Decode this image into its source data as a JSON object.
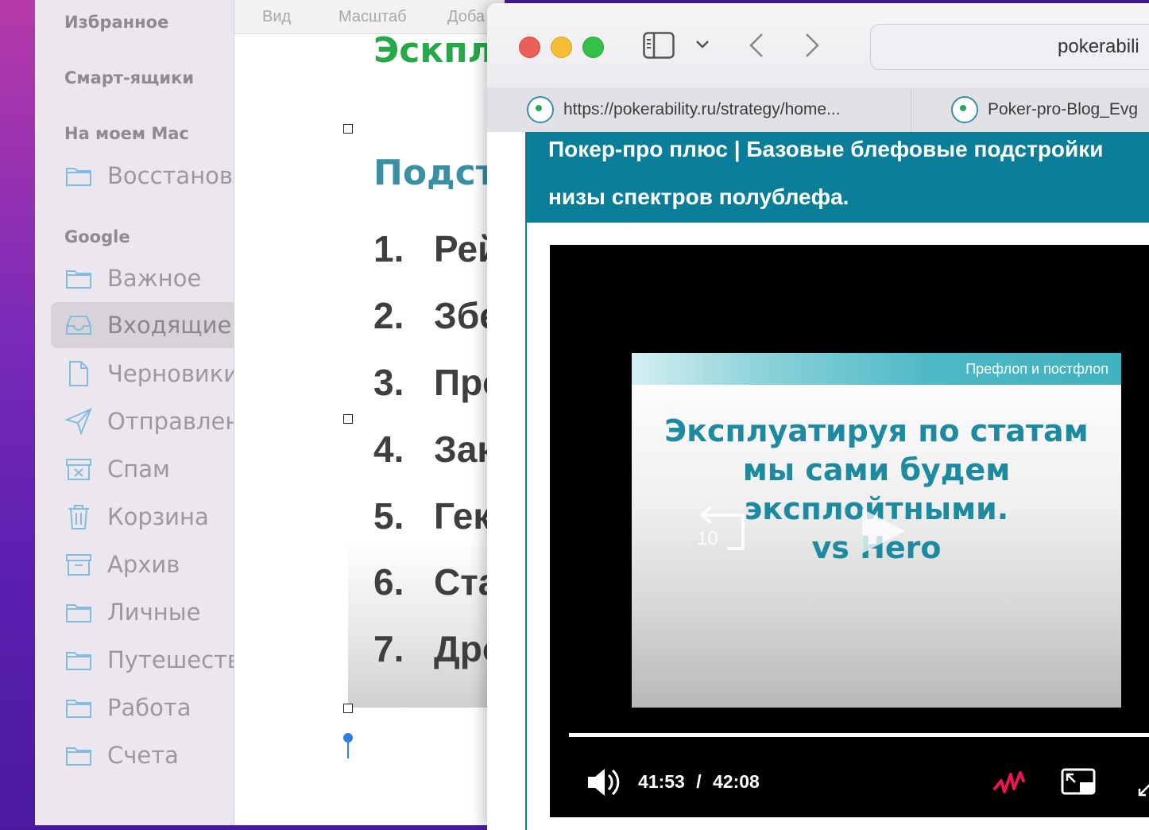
{
  "mail_sidebar": {
    "sections": [
      "Избранное",
      "Смарт-ящики",
      "На моем Mac",
      "Google"
    ],
    "local_folder": "Восстановл",
    "items": [
      {
        "label": "Важное",
        "icon": "folder-icon"
      },
      {
        "label": "Входящие",
        "icon": "inbox-icon",
        "selected": true
      },
      {
        "label": "Черновики",
        "icon": "draft-icon"
      },
      {
        "label": "Отправлен",
        "icon": "send-icon"
      },
      {
        "label": "Спам",
        "icon": "spam-icon"
      },
      {
        "label": "Корзина",
        "icon": "trash-icon"
      },
      {
        "label": "Архив",
        "icon": "archive-icon"
      },
      {
        "label": "Личные",
        "icon": "folder-icon"
      },
      {
        "label": "Путешеств",
        "icon": "folder-icon"
      },
      {
        "label": "Работа",
        "icon": "folder-icon"
      },
      {
        "label": "Счета",
        "icon": "folder-icon"
      }
    ]
  },
  "doc": {
    "menu": [
      "Вид",
      "Масштаб",
      "Доба"
    ],
    "title_partial": "Эскпл",
    "subtitle_partial": "Подст",
    "list": [
      {
        "num": "1.",
        "text": "Рей"
      },
      {
        "num": "2.",
        "text": "Збе"
      },
      {
        "num": "3.",
        "text": "Про"
      },
      {
        "num": "4.",
        "text": "Зак"
      },
      {
        "num": "5.",
        "text": "Гек"
      },
      {
        "num": "6.",
        "text": "Ста"
      },
      {
        "num": "7.",
        "text": "Дро"
      }
    ]
  },
  "browser": {
    "url_display": "pokerabili",
    "tabs": [
      {
        "label": "https://pokerability.ru/strategy/home..."
      },
      {
        "label": "Poker-pro-Blog_Evg"
      }
    ],
    "banner_line1": "Покер-про плюс | Базовые блефовые подстройки",
    "banner_line2": "низы спектров полублефа.",
    "video": {
      "slide_header": "Префлоп и постфлоп",
      "slide_lines": [
        "Эксплуатируя по статам",
        "мы сами будем",
        "эксплойтными.",
        "vs Hero"
      ],
      "skip_label": "10",
      "current_time": "41:53",
      "separator": "/",
      "duration": "42:08",
      "progress": 0.995
    }
  },
  "colors": {
    "banner": "#0a7d98",
    "slide_text": "#1e8aa0",
    "accent_red": "#e8174f"
  }
}
